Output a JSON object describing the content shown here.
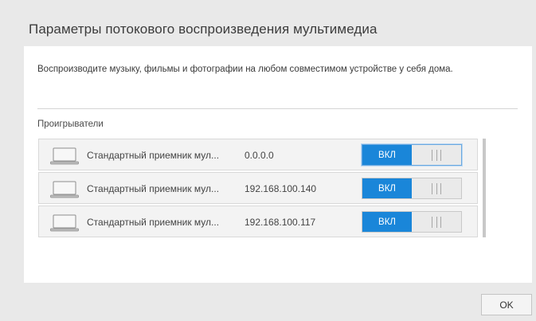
{
  "dialog": {
    "title": "Параметры потокового воспроизведения мультимедиа",
    "intro": "Воспроизводите музыку, фильмы и фотографии на любом совместимом устройстве у себя дома.",
    "players_label": "Проигрыватели",
    "ok_label": "OK"
  },
  "players": [
    {
      "name": "Стандартный приемник мул...",
      "ip": "0.0.0.0",
      "toggle_label": "ВКЛ",
      "state": "on",
      "icon": "laptop-icon"
    },
    {
      "name": "Стандартный приемник мул...",
      "ip": "192.168.100.140",
      "toggle_label": "ВКЛ",
      "state": "on",
      "icon": "laptop-icon"
    },
    {
      "name": "Стандартный приемник мул...",
      "ip": "192.168.100.117",
      "toggle_label": "ВКЛ",
      "state": "on",
      "icon": "laptop-icon"
    }
  ],
  "colors": {
    "accent": "#1a86d9",
    "background": "#e9e9e9",
    "panel": "#ffffff",
    "row": "#f3f3f3"
  }
}
